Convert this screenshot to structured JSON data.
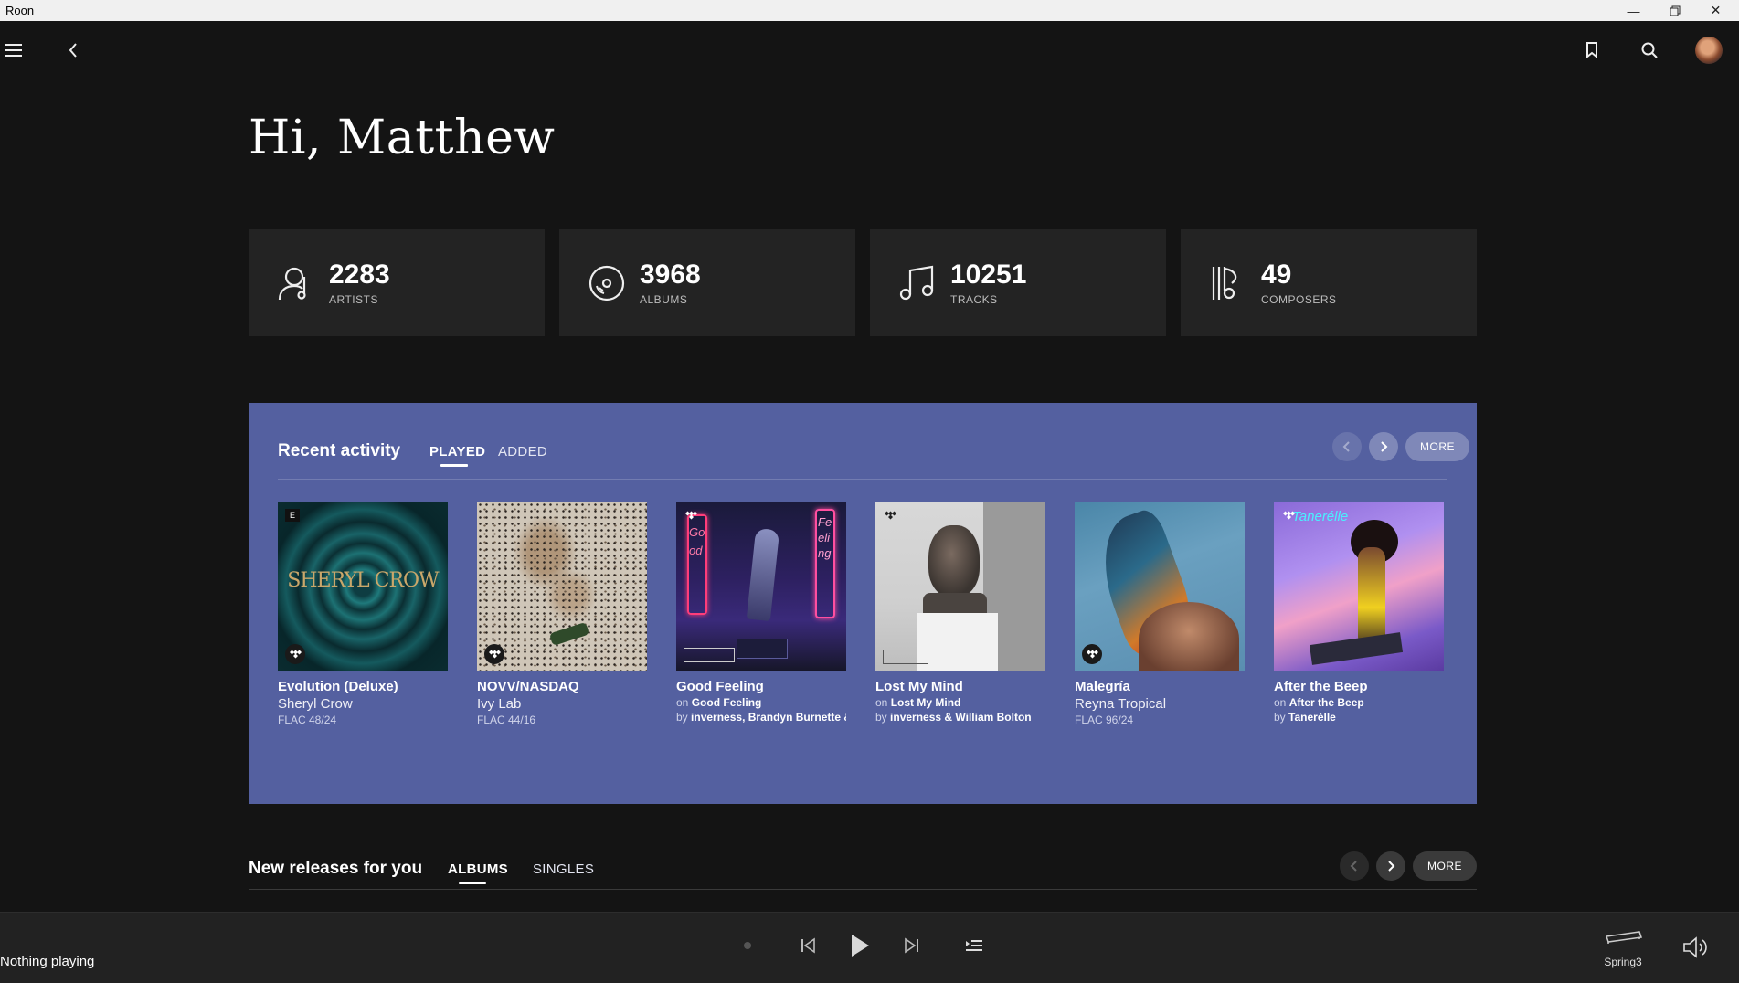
{
  "window": {
    "title": "Roon"
  },
  "greeting": "Hi, Matthew",
  "stats": [
    {
      "value": "2283",
      "label": "ARTISTS",
      "icon": "artist-icon"
    },
    {
      "value": "3968",
      "label": "ALBUMS",
      "icon": "album-disc-icon"
    },
    {
      "value": "10251",
      "label": "TRACKS",
      "icon": "music-note-icon"
    },
    {
      "value": "49",
      "label": "COMPOSERS",
      "icon": "composer-icon"
    }
  ],
  "recent": {
    "title": "Recent activity",
    "tabs": [
      "PLAYED",
      "ADDED"
    ],
    "active_tab": "PLAYED",
    "more_label": "MORE",
    "background": "#5460a0",
    "items": [
      {
        "title": "Evolution (Deluxe)",
        "line2": "Sheryl Crow",
        "line3": "FLAC 48/24",
        "badge_tl": "E",
        "source": "tidal"
      },
      {
        "title": "NOVV/NASDAQ",
        "line2": "Ivy Lab",
        "line3": "FLAC 44/16",
        "source": "tidal"
      },
      {
        "title": "Good Feeling",
        "on_prefix": "on",
        "on_value": "Good Feeling",
        "by_prefix": "by",
        "by_value": "inverness, Brandyn Burnette & T",
        "source": "tidal"
      },
      {
        "title": "Lost My Mind",
        "on_prefix": "on",
        "on_value": "Lost My Mind",
        "by_prefix": "by",
        "by_value": "inverness & William Bolton",
        "source": "tidal"
      },
      {
        "title": "Malegría",
        "line2": "Reyna Tropical",
        "line3": "FLAC 96/24",
        "source": "tidal"
      },
      {
        "title": "After the Beep",
        "on_prefix": "on",
        "on_value": "After the Beep",
        "by_prefix": "by",
        "by_value": "Tanerélle",
        "source": "tidal"
      }
    ],
    "cover_art_text": {
      "sheryl": "SHERYL CROW",
      "good_left": "Good",
      "good_right": "Feeling",
      "taner": "Tanerélle"
    }
  },
  "new_releases": {
    "title": "New releases for you",
    "tabs": [
      "ALBUMS",
      "SINGLES"
    ],
    "active_tab": "ALBUMS",
    "more_label": "MORE"
  },
  "player": {
    "now_playing": "Nothing playing",
    "zone_name": "Spring3",
    "progress": 0
  }
}
